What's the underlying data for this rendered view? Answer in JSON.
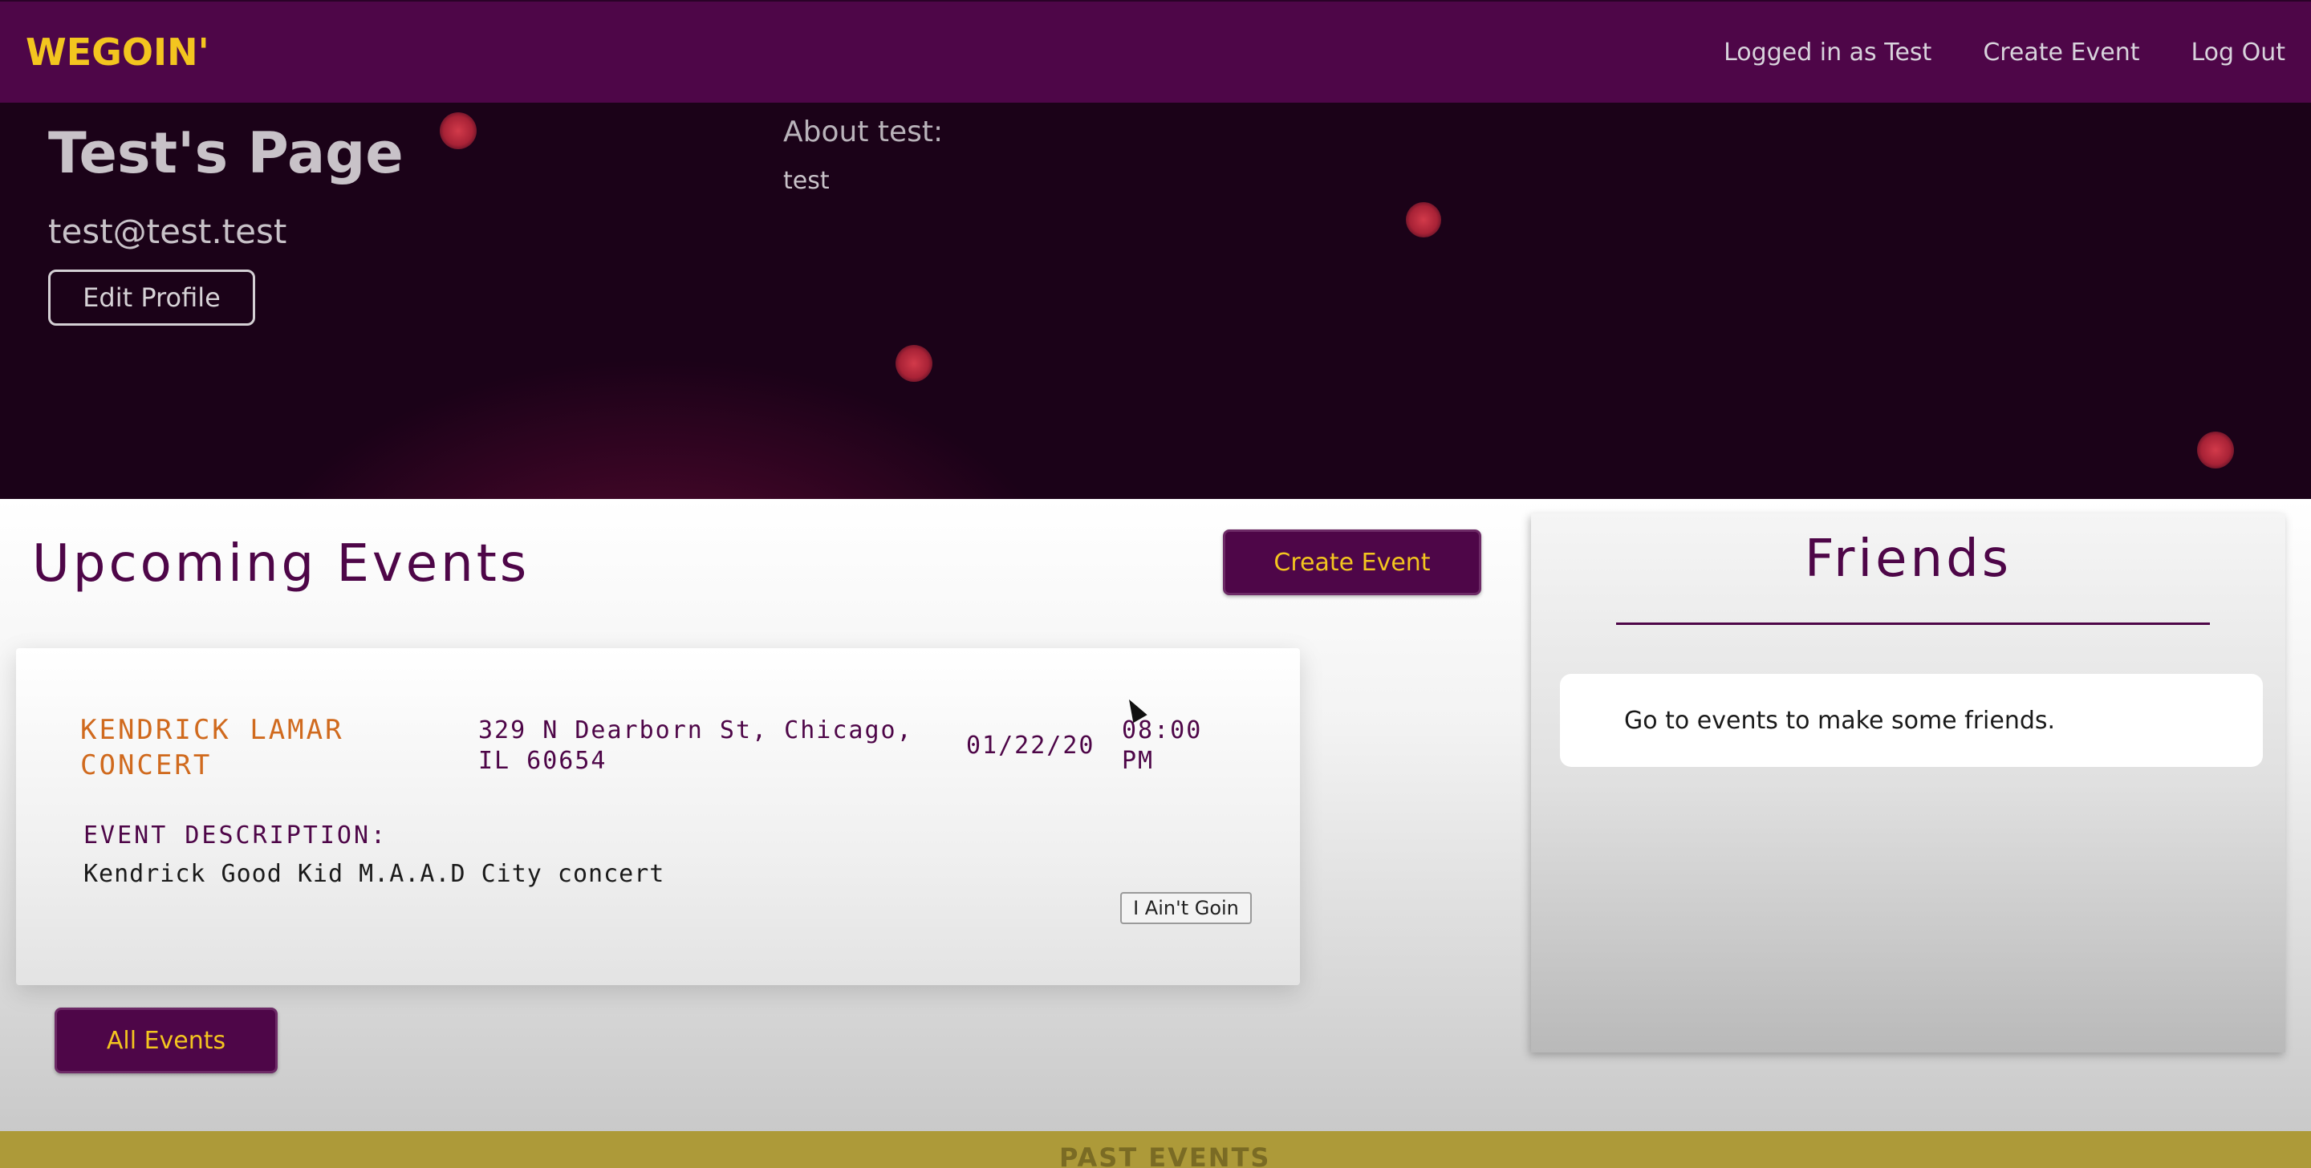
{
  "navbar": {
    "logo": "WEGOIN'",
    "links": [
      {
        "label": "Logged in as Test"
      },
      {
        "label": "Create Event"
      },
      {
        "label": "Log Out"
      }
    ]
  },
  "profile": {
    "title": "Test's Page",
    "email": "test@test.test",
    "edit_button": "Edit Profile",
    "about_label": "About test:",
    "about_text": "test"
  },
  "upcoming": {
    "title": "Upcoming Events",
    "create_button": "Create Event",
    "all_button": "All Events",
    "events": [
      {
        "name": "KENDRICK LAMAR CONCERT",
        "address": "329 N Dearborn St, Chicago, IL 60654",
        "date": "01/22/20",
        "time": "08:00 PM",
        "description_label": "EVENT DESCRIPTION:",
        "description": "Kendrick Good Kid M.A.A.D City concert",
        "rsvp_button": "I Ain't Goin"
      }
    ]
  },
  "friends": {
    "title": "Friends",
    "empty_message": "Go to events to make some friends."
  },
  "footer": {
    "label": "PAST EVENTS"
  },
  "colors": {
    "brand_purple": "#4e0648",
    "brand_gold": "#f3c51f",
    "event_name_orange": "#d06a1e",
    "footer_gold": "#ad9a39"
  }
}
